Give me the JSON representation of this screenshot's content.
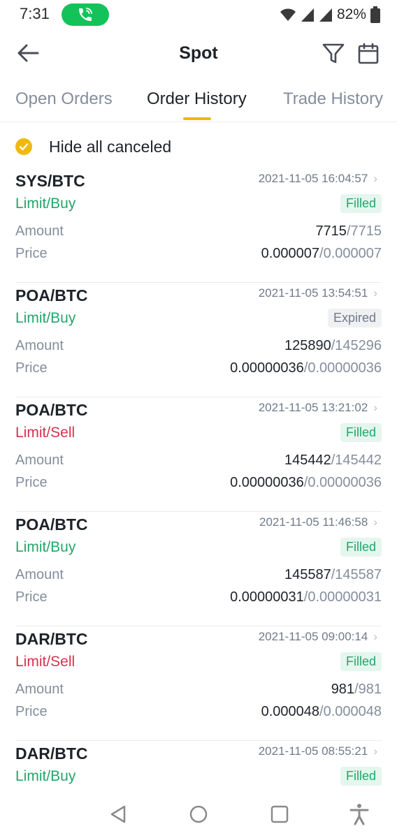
{
  "status_bar": {
    "time": "7:31",
    "battery": "82%",
    "call_color": "#13c35a"
  },
  "header": {
    "title": "Spot",
    "back_icon": "arrow-left-icon",
    "filter_icon": "funnel-icon",
    "calendar_icon": "calendar-icon"
  },
  "tabs": [
    {
      "label": "Open Orders",
      "active": false
    },
    {
      "label": "Order History",
      "active": true
    },
    {
      "label": "Trade History",
      "active": false
    }
  ],
  "accent_color": "#f0b90b",
  "hide_canceled": {
    "label": "Hide all canceled",
    "checked": true
  },
  "labels": {
    "amount": "Amount",
    "price": "Price"
  },
  "orders": [
    {
      "pair": "SYS/BTC",
      "side": "Limit/Buy",
      "datetime": "2021-11-05 16:04:57",
      "status": "Filled",
      "amount_filled": "7715",
      "amount_total": "/7715",
      "price_avg": "0.000007",
      "price_order": "/0.000007"
    },
    {
      "pair": "POA/BTC",
      "side": "Limit/Buy",
      "datetime": "2021-11-05 13:54:51",
      "status": "Expired",
      "amount_filled": "125890",
      "amount_total": "/145296",
      "price_avg": "0.00000036",
      "price_order": "/0.00000036"
    },
    {
      "pair": "POA/BTC",
      "side": "Limit/Sell",
      "datetime": "2021-11-05 13:21:02",
      "status": "Filled",
      "amount_filled": "145442",
      "amount_total": "/145442",
      "price_avg": "0.00000036",
      "price_order": "/0.00000036"
    },
    {
      "pair": "POA/BTC",
      "side": "Limit/Buy",
      "datetime": "2021-11-05 11:46:58",
      "status": "Filled",
      "amount_filled": "145587",
      "amount_total": "/145587",
      "price_avg": "0.00000031",
      "price_order": "/0.00000031"
    },
    {
      "pair": "DAR/BTC",
      "side": "Limit/Sell",
      "datetime": "2021-11-05 09:00:14",
      "status": "Filled",
      "amount_filled": "981",
      "amount_total": "/981",
      "price_avg": "0.000048",
      "price_order": "/0.000048"
    },
    {
      "pair": "DAR/BTC",
      "side": "Limit/Buy",
      "datetime": "2021-11-05 08:55:21",
      "status": "Filled"
    }
  ],
  "nav_bar": {
    "back_icon": "triangle-back-icon",
    "home_icon": "circle-home-icon",
    "recents_icon": "square-recents-icon",
    "accessibility_icon": "accessibility-icon"
  }
}
